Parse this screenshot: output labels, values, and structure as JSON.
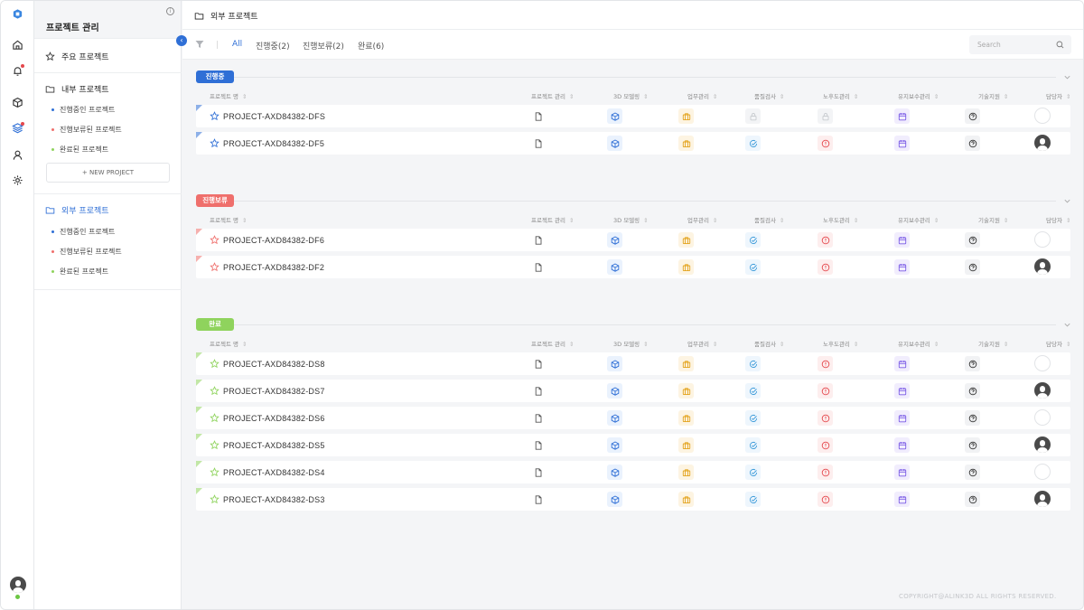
{
  "sidebar": {
    "title": "프로젝트 관리",
    "favorites": "주요 프로젝트",
    "internal": {
      "label": "내부 프로젝트",
      "items": [
        "진행중인 프로젝트",
        "진행보류된 프로젝트",
        "완료된 프로젝트"
      ]
    },
    "new_project": "+ NEW PROJECT",
    "external": {
      "label": "외부 프로젝트",
      "items": [
        "진행중인 프로젝트",
        "진행보류된 프로젝트",
        "완료된 프로젝트"
      ]
    }
  },
  "header": {
    "breadcrumb": "외부 프로젝트"
  },
  "filters": {
    "tabs": [
      "All",
      "진행중(2)",
      "진행보류(2)",
      "완료(6)"
    ],
    "search_placeholder": "Search"
  },
  "columns": [
    "프로젝트 명",
    "프로젝트 관리",
    "3D 모델링",
    "업무관리",
    "품질검사",
    "노후도관리",
    "유지보수관리",
    "기술지원",
    "담당자"
  ],
  "groups": [
    {
      "label": "진행중",
      "color": "#2f6fd6",
      "rows": [
        {
          "name": "PROJECT-AXD84382-DFS",
          "locked": true,
          "avatar": false
        },
        {
          "name": "PROJECT-AXD84382-DF5",
          "locked": false,
          "avatar": true
        }
      ]
    },
    {
      "label": "진행보류",
      "color": "#ef6f6c",
      "rows": [
        {
          "name": "PROJECT-AXD84382-DF6",
          "locked": false,
          "avatar": false
        },
        {
          "name": "PROJECT-AXD84382-DF2",
          "locked": false,
          "avatar": true
        }
      ]
    },
    {
      "label": "완료",
      "color": "#8fd35d",
      "rows": [
        {
          "name": "PROJECT-AXD84382-DS8",
          "locked": false,
          "avatar": false
        },
        {
          "name": "PROJECT-AXD84382-DS7",
          "locked": false,
          "avatar": true
        },
        {
          "name": "PROJECT-AXD84382-DS6",
          "locked": false,
          "avatar": false
        },
        {
          "name": "PROJECT-AXD84382-DS5",
          "locked": false,
          "avatar": true
        },
        {
          "name": "PROJECT-AXD84382-DS4",
          "locked": false,
          "avatar": false
        },
        {
          "name": "PROJECT-AXD84382-DS3",
          "locked": false,
          "avatar": true
        }
      ]
    }
  ],
  "footer": "COPYRIGHT@ALINK3D ALL RIGHTS RESERVED."
}
